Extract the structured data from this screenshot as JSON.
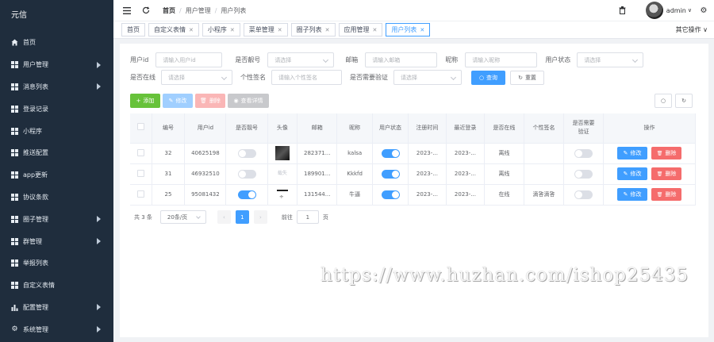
{
  "sidebar": {
    "brand": "元信",
    "items": [
      {
        "label": "首页",
        "icon": "home-icon",
        "has_children": false
      },
      {
        "label": "用户管理",
        "icon": "grid-icon",
        "has_children": true
      },
      {
        "label": "消息列表",
        "icon": "grid-icon",
        "has_children": true
      },
      {
        "label": "登录记录",
        "icon": "grid-icon",
        "has_children": false
      },
      {
        "label": "小程序",
        "icon": "grid-icon",
        "has_children": false
      },
      {
        "label": "推送配置",
        "icon": "grid-icon",
        "has_children": false
      },
      {
        "label": "app更新",
        "icon": "grid-icon",
        "has_children": false
      },
      {
        "label": "协议条款",
        "icon": "grid-icon",
        "has_children": false
      },
      {
        "label": "圈子管理",
        "icon": "grid-icon",
        "has_children": true
      },
      {
        "label": "群管理",
        "icon": "grid-icon",
        "has_children": true
      },
      {
        "label": "举报列表",
        "icon": "grid-icon",
        "has_children": false
      },
      {
        "label": "自定义表情",
        "icon": "grid-icon",
        "has_children": false
      },
      {
        "label": "配置管理",
        "icon": "bar-chart-icon",
        "has_children": true
      },
      {
        "label": "系统管理",
        "icon": "gear-icon",
        "has_children": true
      }
    ]
  },
  "topbar": {
    "breadcrumb": [
      "首页",
      "用户管理",
      "用户列表"
    ],
    "user_name": "admin"
  },
  "tags": {
    "items": [
      {
        "label": "首页",
        "closable": false,
        "active": false
      },
      {
        "label": "自定义表情",
        "closable": true,
        "active": false
      },
      {
        "label": "小程序",
        "closable": true,
        "active": false
      },
      {
        "label": "菜单管理",
        "closable": true,
        "active": false
      },
      {
        "label": "圈子列表",
        "closable": true,
        "active": false
      },
      {
        "label": "应用管理",
        "closable": true,
        "active": false
      },
      {
        "label": "用户列表",
        "closable": true,
        "active": true
      }
    ],
    "other_ops": "其它操作"
  },
  "search": {
    "user_id": {
      "label": "用户id",
      "placeholder": "请输入用户id"
    },
    "is_pretty": {
      "label": "是否靓号",
      "placeholder": "请选择"
    },
    "email": {
      "label": "邮箱",
      "placeholder": "请输入邮箱"
    },
    "nickname": {
      "label": "昵称",
      "placeholder": "请输入昵称"
    },
    "status": {
      "label": "用户状态",
      "placeholder": "请选择"
    },
    "online": {
      "label": "是否在线",
      "placeholder": "请选择"
    },
    "signature": {
      "label": "个性签名",
      "placeholder": "请输入个性签名"
    },
    "verify": {
      "label": "是否需要验证",
      "placeholder": "请选择"
    },
    "query_label": "查询",
    "reset_label": "重置"
  },
  "toolbar": {
    "add_label": "添加",
    "edit_label": "修改",
    "delete_label": "删除",
    "view_label": "查看详情"
  },
  "table": {
    "columns": [
      "编号",
      "用户id",
      "是否靓号",
      "头像",
      "邮箱",
      "昵称",
      "用户状态",
      "注册时间",
      "最近登录",
      "是否在线",
      "个性签名",
      "是否需要验证",
      "操作"
    ],
    "rows": [
      {
        "no": "32",
        "uid": "40625198",
        "pretty": false,
        "avatar": "dark",
        "email": "282371...",
        "nick": "kalsa",
        "status": true,
        "reg": "2023-...",
        "last": "2023-...",
        "online": "离线",
        "sign": "",
        "verify": false
      },
      {
        "no": "31",
        "uid": "46932510",
        "pretty": false,
        "avatar": "broken",
        "avatar_alt": "载失",
        "email": "189901...",
        "nick": "Kkkfd",
        "status": true,
        "reg": "2023-...",
        "last": "2023-...",
        "online": "离线",
        "sign": "",
        "verify": false
      },
      {
        "no": "25",
        "uid": "95081432",
        "pretty": true,
        "avatar": "mini",
        "email": "131544...",
        "nick": "牛逼",
        "status": true,
        "reg": "2023-...",
        "last": "2023-...",
        "online": "在线",
        "sign": "滴答滴答",
        "verify": false
      }
    ],
    "edit_label": "修改",
    "delete_label": "删除"
  },
  "pager": {
    "total": "共 3 条",
    "page_size": "20条/页",
    "current": "1",
    "goto_label": "前往",
    "goto_value": "1",
    "page_unit": "页"
  },
  "watermark": "https://www.huzhan.com/ishop25435",
  "colors": {
    "sidebar": "#1f2d3d",
    "primary": "#409eff",
    "success": "#67c23a",
    "danger": "#f56c6c"
  }
}
